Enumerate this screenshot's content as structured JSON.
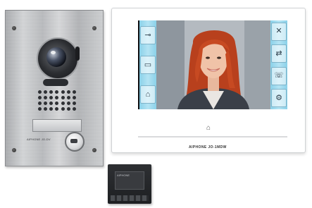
{
  "door_station": {
    "brand_label": "AIPHONE JO-DV"
  },
  "monitor": {
    "left_buttons": [
      {
        "icon": "key-icon",
        "glyph": "⊸"
      },
      {
        "icon": "panel-icon",
        "glyph": "▭"
      },
      {
        "icon": "door-icon",
        "glyph": "⌂"
      }
    ],
    "right_buttons": [
      {
        "icon": "close-icon",
        "glyph": "✕"
      },
      {
        "icon": "transfer-icon",
        "glyph": "⇄"
      },
      {
        "icon": "call-icon",
        "glyph": "☏"
      },
      {
        "icon": "settings-gear-icon",
        "glyph": "⚙"
      }
    ],
    "home_glyph": "⌂",
    "brand_label": "AIPHONE JO-1MDW"
  },
  "power_supply": {
    "label": "AIPHONE"
  },
  "colors": {
    "screen_panel": "#8ad1e9",
    "hair": "#c0431f",
    "steel": "#c4c6c9"
  }
}
